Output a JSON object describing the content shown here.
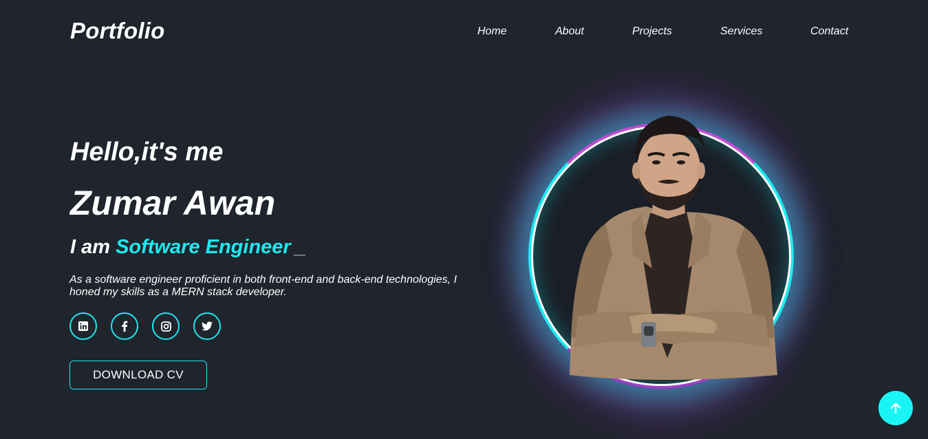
{
  "header": {
    "logo": "Portfolio",
    "nav": [
      "Home",
      "About",
      "Projects",
      "Services",
      "Contact"
    ]
  },
  "hero": {
    "greeting": "Hello,it's me",
    "name": "Zumar Awan",
    "role_prefix": "I am",
    "role_highlight": "Software Engineer",
    "cursor": "_",
    "description": "As a software engineer proficient in both front-end and back-end technologies, I honed my skills as a MERN stack developer.",
    "socials": [
      "linkedin-icon",
      "facebook-icon",
      "instagram-icon",
      "twitter-icon"
    ],
    "cv_button": "DOWNLOAD CV"
  },
  "colors": {
    "background": "#1f242d",
    "accent": "#1de9f0",
    "ring_magenta": "#c04fd0",
    "scroll_top_button": "#19f5f5"
  }
}
